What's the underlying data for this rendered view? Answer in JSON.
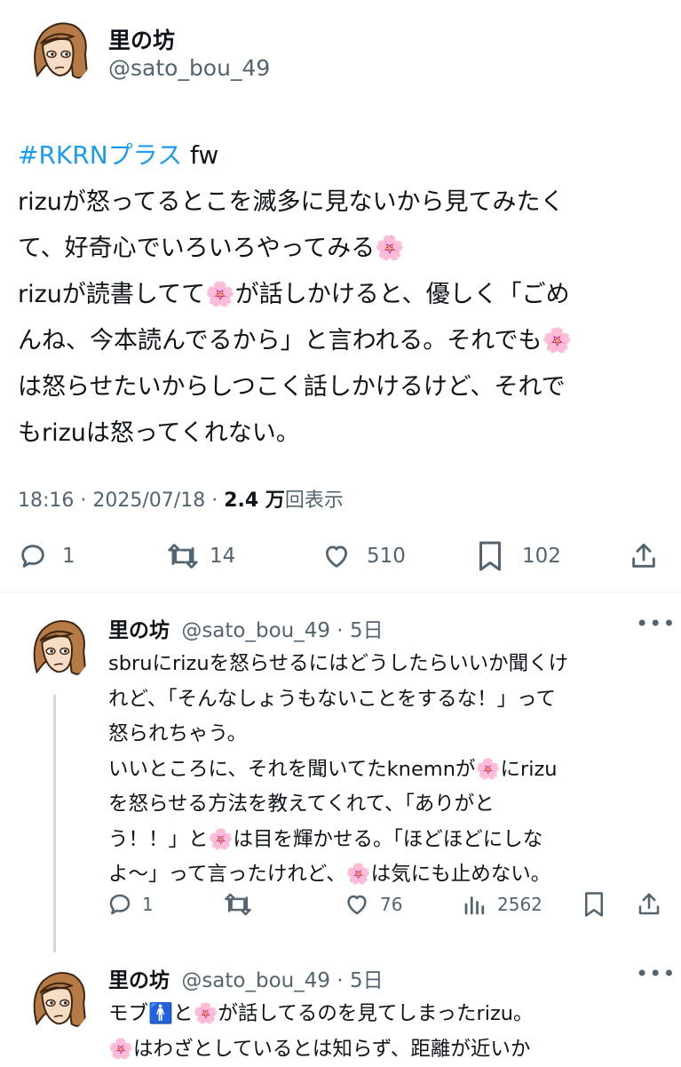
{
  "main_tweet": {
    "display_name": "里の坊",
    "handle": "@sato_bou_49",
    "hashtag": "#RKRNプラス",
    "hashtag_suffix": " fw",
    "body": "rizuが怒ってるとこを滅多に見ないから見てみたく\nて、好奇心でいろいろやってみる🌸\nrizuが読書してて🌸が話しかけると、優しく「ごめ\nんね、今本読んでるから」と言われる。それでも🌸\nは怒らせたいからしつこく話しかけるけど、それで\nもrizuは怒ってくれない。",
    "time": "18:16",
    "date": "2025/07/18",
    "views_number": "2.4 万",
    "views_label": "回表示",
    "replies": "1",
    "retweets": "14",
    "likes": "510",
    "bookmarks": "102"
  },
  "replies": [
    {
      "display_name": "里の坊",
      "handle": "@sato_bou_49",
      "age": "5日",
      "body": "sbruにrizuを怒らせるにはどうしたらいいか聞くけ\nれど、「そんなしょうもないことをするな！」って\n怒られちゃう。\nいいところに、それを聞いてたknemnが🌸にrizu\nを怒らせる方法を教えてくれて、「ありがと\nう！！」と🌸は目を輝かせる。「ほどほどにしな\nよ～」って言ったけれど、🌸は気にも止めない。",
      "replies": "1",
      "likes": "76",
      "views": "2562"
    },
    {
      "display_name": "里の坊",
      "handle": "@sato_bou_49",
      "age": "5日",
      "body": "モブ🚹と🌸が話してるのを見てしまったrizu。\n🌸はわざとしているとは知らず、距離が近いか"
    }
  ],
  "dot_separator": " · "
}
